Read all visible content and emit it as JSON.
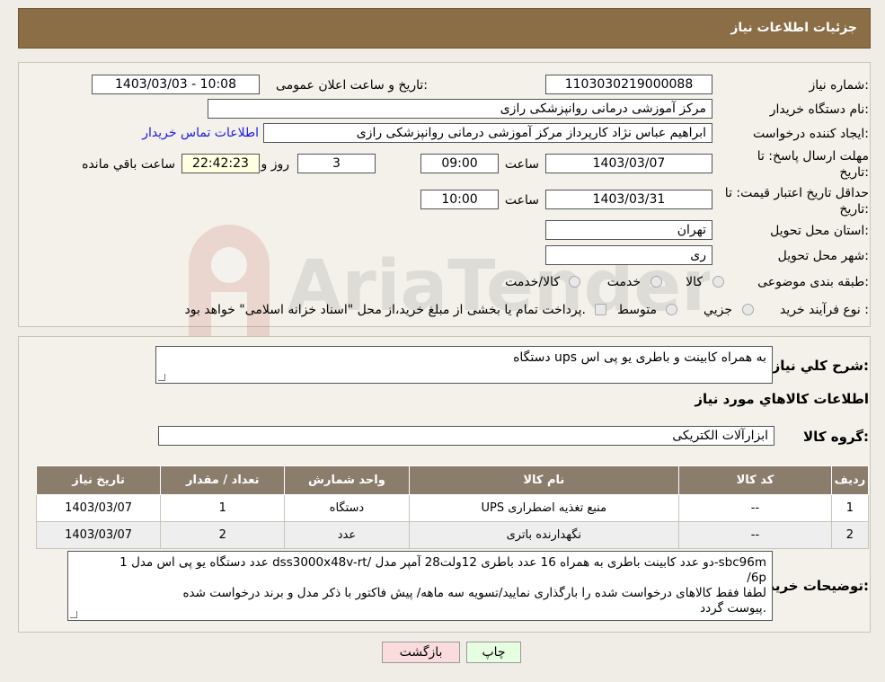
{
  "header": {
    "title": "جزئیات اطلاعات نیاز"
  },
  "form": {
    "need_number_label": "شماره نیاز:",
    "need_number": "1103030219000088",
    "announce_label": "تاریخ و ساعت اعلان عمومی:",
    "announce_value": "1403/03/03 - 10:08",
    "buyer_org_label": "نام دستگاه خریدار:",
    "buyer_org": "مرکز آموزشی درمانی روانپزشکی رازی",
    "creator_label": "ایجاد کننده درخواست:",
    "creator": "ابراهیم عباس نژاد کارپرداز مرکز آموزشی درمانی روانپزشکی رازی",
    "contact_link": "اطلاعات تماس خریدار",
    "deadline_label_1": "مهلت ارسال پاسخ: تا",
    "deadline_label_2": "تاریخ:",
    "deadline_date": "1403/03/07",
    "time_word": "ساعت",
    "deadline_time": "09:00",
    "days_value": "3",
    "days_word": "روز و",
    "remaining_time": "22:42:23",
    "remaining_word": "ساعت باقي مانده",
    "validity_label_1": "حداقل تاریخ اعتبار قیمت: تا",
    "validity_label_2": "تاریخ:",
    "validity_date": "1403/03/31",
    "validity_time": "10:00",
    "province_label": "استان محل تحویل:",
    "province": "تهران",
    "city_label": "شهر محل تحویل:",
    "city": "ری",
    "category_label": "طبقه بندی موضوعی:",
    "category_options": [
      "کالا",
      "خدمت",
      "کالا/خدمت"
    ],
    "process_label": "نوع فرآیند خرید :",
    "process_options": [
      "جزیي",
      "متوسط"
    ],
    "process_note": "پرداخت تمام یا بخشی از مبلغ خرید،از محل \"اسناد خزانه اسلامی\" خواهد بود."
  },
  "details": {
    "summary_label": "شرح كلي نياز:",
    "summary": "دستگاه ups به همراه کابینت و باطری یو پی اس",
    "goods_info_title": "اطلاعات کالاهاي مورد نياز",
    "group_label": "گروه کالا:",
    "group_value": "ابزارآلات الکتریکی",
    "table": {
      "headers": [
        "رديف",
        "کد کالا",
        "نام کالا",
        "واحد شمارش",
        "تعداد / مقدار",
        "تاریخ نیاز"
      ],
      "rows": [
        [
          "1",
          "--",
          "منبع تغذیه اضطراری UPS",
          "دستگاه",
          "1",
          "1403/03/07"
        ],
        [
          "2",
          "--",
          "نگهدارنده باتری",
          "عدد",
          "2",
          "1403/03/07"
        ]
      ]
    },
    "notes_label": "توضیحات خریدار:",
    "notes_lines": [
      "1 عدد دستگاه یو پی اس مدل dss3000x48v-rt/ دو عدد کابینت باطری به همراه 16 عدد باطری 12ولت28 آمپر مدل-sbc96m",
      "/6p",
      "لطفا فقط کالاهای درخواست شده را بارگذاری نمایید/تسویه سه ماهه/ پیش فاکتور با ذکر مدل و برند درخواست شده",
      "پیوست گردد."
    ]
  },
  "buttons": {
    "print": "چاپ",
    "back": "بازگشت"
  },
  "watermark": "AriaTender.neT",
  "colors": {
    "header_bg": "#8b6d46",
    "table_header_bg": "#8b7d6b",
    "link": "#1a1ae6",
    "back_btn": "#fbdcdc",
    "print_btn": "#e6ffe0"
  }
}
